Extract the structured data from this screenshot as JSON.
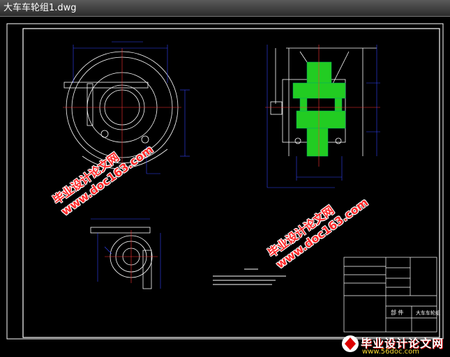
{
  "window": {
    "title": "大车车轮组1.dwg"
  },
  "drawing": {
    "title_block": {
      "part_label": "部 件",
      "name_label": "大车车轮组"
    }
  },
  "watermark": {
    "line1": "毕业设计论文网",
    "line2": "www.doc163.com"
  },
  "logo": {
    "name": "毕业设计论文网",
    "url": "www.56doc.com"
  },
  "colors": {
    "background": "#000000",
    "frame": "#ffffff",
    "dimension": "#3344ff",
    "centerline": "#ff3333",
    "gear_fill": "#22cc22",
    "watermark": "#ff2a2a"
  }
}
